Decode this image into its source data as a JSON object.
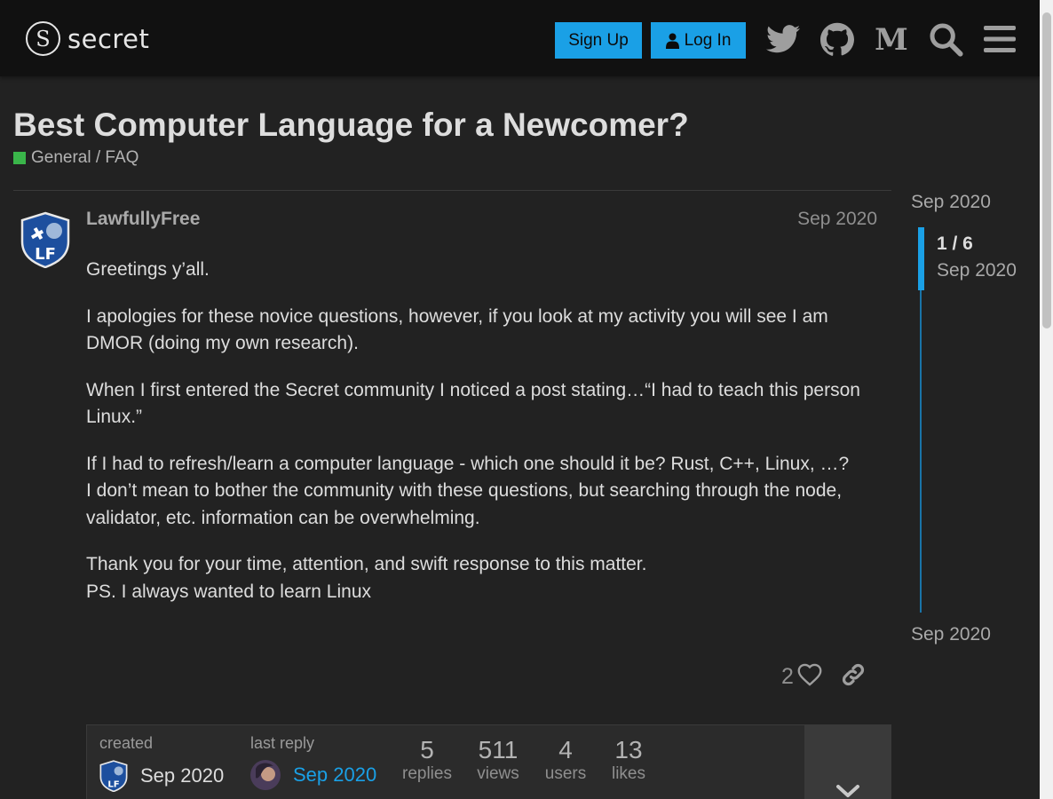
{
  "header": {
    "logo_text": "secret",
    "signup_label": "Sign Up",
    "login_label": "Log In",
    "icons": [
      "twitter-icon",
      "github-icon",
      "medium-icon",
      "search-icon",
      "hamburger-menu-icon"
    ]
  },
  "topic": {
    "title": "Best Computer Language for a Newcomer?",
    "category": "General / FAQ",
    "category_color": "#3ab54a"
  },
  "post": {
    "author": "LawfullyFree",
    "date": "Sep 2020",
    "paragraphs": [
      "Greetings y’all.",
      "I apologies for these novice questions, however, if you look at my activity you will see I am DMOR (doing my own research).",
      "When I first entered the Secret community I noticed a post stating…“I had to teach this person Linux.”",
      "If I had to refresh/learn a computer language - which one should it be? Rust, C++, Linux, …?",
      "I don’t mean to bother the community with these questions, but searching through the node, validator, etc. information can be overwhelming.",
      "Thank you for your time, attention, and swift response to this matter.",
      "PS. I always wanted to learn Linux"
    ],
    "like_count": "2"
  },
  "topic_map": {
    "created_label": "created",
    "created_date": "Sep 2020",
    "last_reply_label": "last reply",
    "last_reply_date": "Sep 2020",
    "replies": "5",
    "replies_label": "replies",
    "views": "511",
    "views_label": "views",
    "users": "4",
    "users_label": "users",
    "likes": "13",
    "likes_label": "likes"
  },
  "timeline": {
    "start": "Sep 2020",
    "counter": "1 / 6",
    "current_date": "Sep 2020",
    "end": "Sep 2020"
  },
  "colors": {
    "accent": "#1aa0e6",
    "background": "#222222",
    "header": "#111111"
  }
}
